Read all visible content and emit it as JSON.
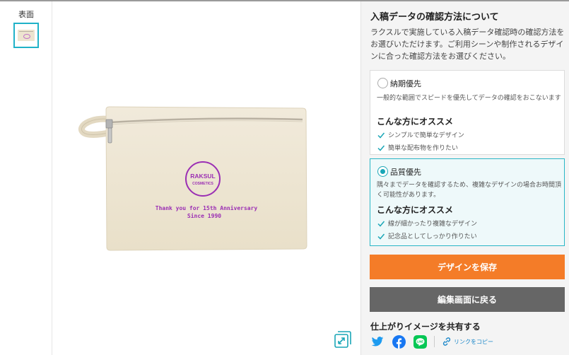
{
  "thumbnail": {
    "label": "表面"
  },
  "preview": {
    "product_logo_line1": "RAKSUL",
    "product_logo_line2": "COSMETICS",
    "product_text_line1": "Thank you for 15th Anniversary",
    "product_text_line2": "Since 1990",
    "print_color": "#9b2fb4",
    "bag_color": "#efe7d4",
    "zoom_icon": "expand-icon"
  },
  "panel": {
    "title": "入稿データの確認方法について",
    "description": "ラクスルで実施している入稿データ確認時の確認方法をお選びいただけます。ご利用シーンや制作されるデザインに合った確認方法をお選びください。",
    "options": [
      {
        "name": "納期優先",
        "selected": false,
        "text": "一般的な範囲でスピードを優先してデータの確認をおこないます",
        "recommend_title": "こんな方にオススメ",
        "items": [
          "シンプルで簡単なデザイン",
          "簡単な配布物を作りたい"
        ]
      },
      {
        "name": "品質優先",
        "selected": true,
        "text": "隅々までデータを確認するため、複雑なデザインの場合お時間頂く可能性があります。",
        "recommend_title": "こんな方にオススメ",
        "items": [
          "線が細かったり複雑なデザイン",
          "記念品としてしっかり作りたい"
        ]
      }
    ],
    "save_button": "デザインを保存",
    "back_button": "編集画面に戻る",
    "share_title": "仕上がりイメージを共有する",
    "share_icons": [
      "twitter-icon",
      "facebook-icon",
      "line-icon"
    ],
    "copy_link": "リンクをコピー",
    "colors": {
      "accent": "#1aa6b7",
      "save": "#f47c28",
      "back": "#666666",
      "twitter": "#1d9bf0",
      "facebook": "#1877f2",
      "line": "#06c755"
    }
  }
}
